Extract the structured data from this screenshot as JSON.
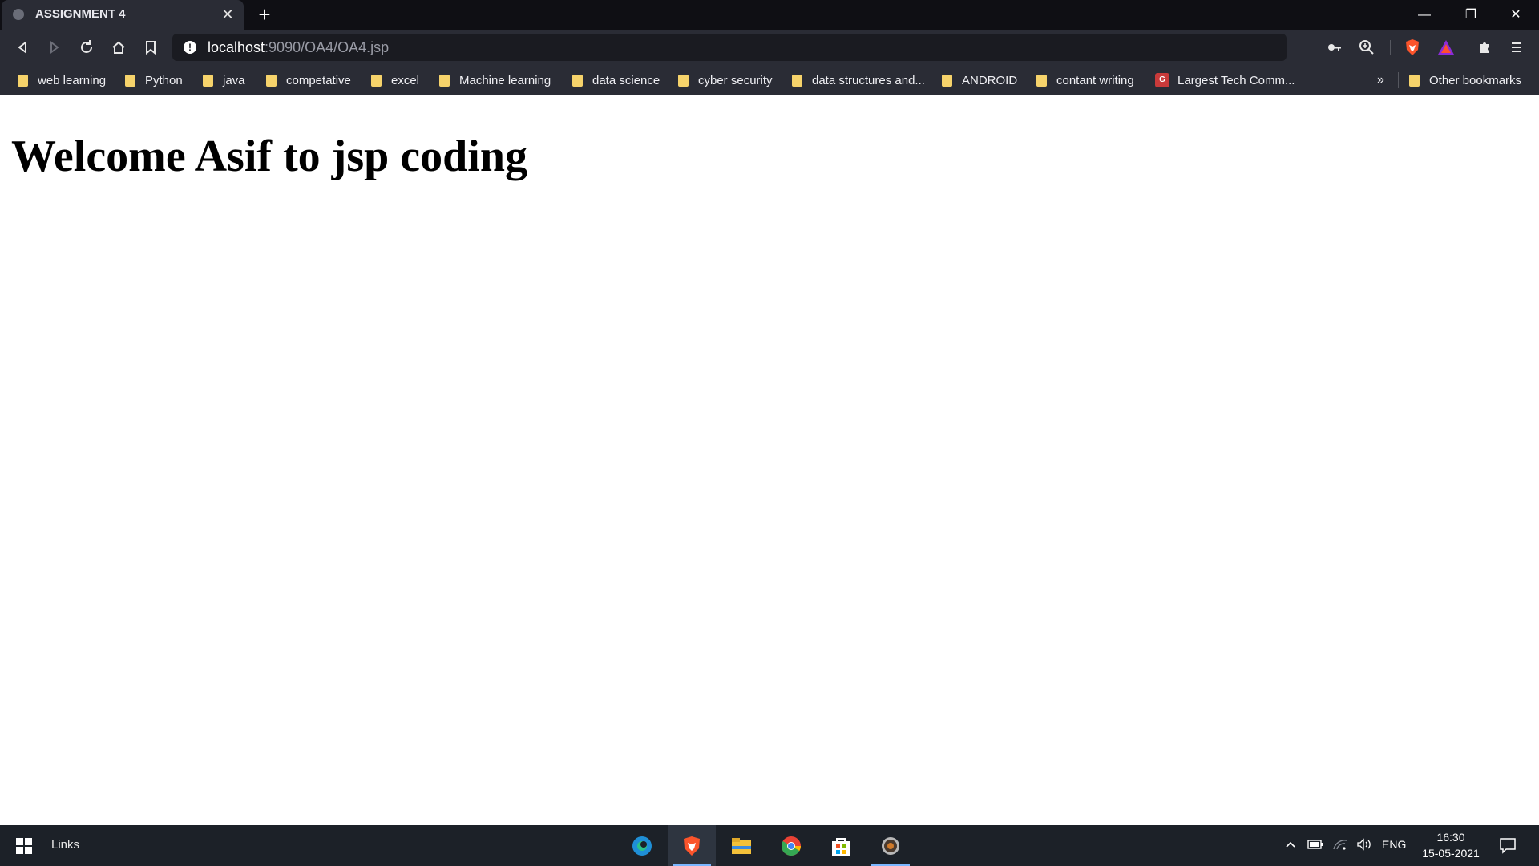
{
  "browser": {
    "tab_title": "ASSIGNMENT 4",
    "url_host": "localhost",
    "url_rest": ":9090/OA4/OA4.jsp",
    "bookmarks": [
      {
        "label": "web learning",
        "icon": "folder-icon"
      },
      {
        "label": "Python",
        "icon": "folder-icon"
      },
      {
        "label": "java",
        "icon": "folder-icon"
      },
      {
        "label": "competative",
        "icon": "folder-icon"
      },
      {
        "label": "excel",
        "icon": "folder-icon"
      },
      {
        "label": "Machine learning",
        "icon": "folder-icon"
      },
      {
        "label": "data science",
        "icon": "folder-icon"
      },
      {
        "label": "cyber security",
        "icon": "folder-icon"
      },
      {
        "label": "data structures and...",
        "icon": "folder-icon"
      },
      {
        "label": "ANDROID",
        "icon": "folder-icon"
      },
      {
        "label": "contant writing",
        "icon": "folder-icon"
      },
      {
        "label": "Largest Tech Comm...",
        "icon": "gfg-icon"
      }
    ],
    "overflow_label": "»",
    "other_bookmarks": "Other bookmarks"
  },
  "page": {
    "heading": "Welcome Asif to jsp coding"
  },
  "taskbar": {
    "links_label": "Links",
    "language": "ENG",
    "time": "16:30",
    "date": "15-05-2021"
  },
  "colors": {
    "tab_strip": "#0f0f14",
    "toolbar": "#2a2c35",
    "brave_orange": "#fb542b",
    "taskbar": "#1c2128"
  }
}
